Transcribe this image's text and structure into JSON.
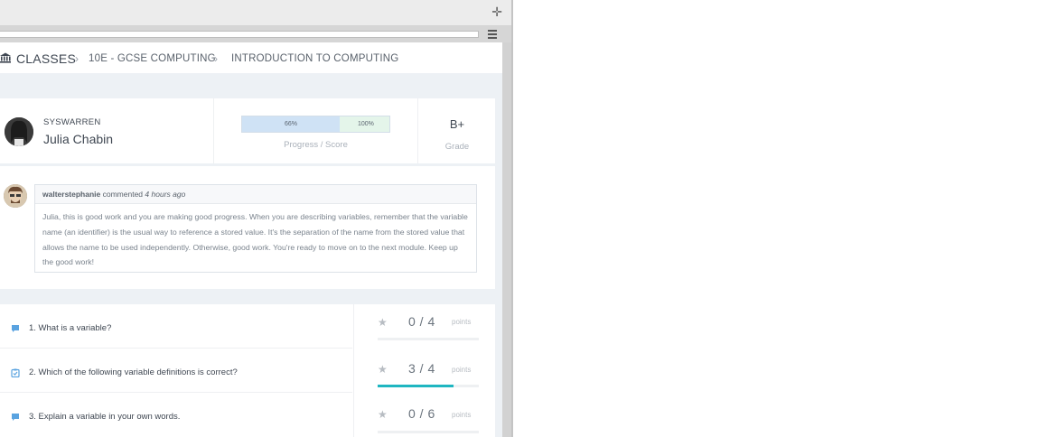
{
  "breadcrumb": {
    "root": "CLASSES",
    "items": [
      "10E - GCSE COMPUTING",
      "INTRODUCTION TO COMPUTING"
    ]
  },
  "student": {
    "username": "SYSWARREN",
    "name": "Julia Chabin",
    "progress_label": "66%",
    "progress_fraction": 0.66,
    "score_label": "100%",
    "progress_caption": "Progress / Score",
    "grade": "B+",
    "grade_caption": "Grade"
  },
  "comment": {
    "author": "walterstephanie",
    "verb": "commented",
    "time": "4 hours ago",
    "body": "Julia, this is good work and you are making good progress. When you are describing variables, remember that the variable name (an identifier) is the usual way to reference a stored value. It's the separation of the name from the stored value that allows the name to be used independently. Otherwise, good work. You're ready to move on to the next module. Keep up the good work!"
  },
  "questions": [
    {
      "text": "1. What is a variable?",
      "score": "0 / 4",
      "points_label": "points",
      "icon": "speech-bubble-icon",
      "fraction": 0
    },
    {
      "text": "2. Which of the following variable definitions is correct?",
      "score": "3 / 4",
      "points_label": "points",
      "icon": "clipboard-check-icon",
      "fraction": 0.75
    },
    {
      "text": "3. Explain a variable in your own words.",
      "score": "0 / 6",
      "points_label": "points",
      "icon": "speech-bubble-icon",
      "fraction": 0
    }
  ],
  "colors": {
    "accent": "#1fb6c1",
    "progress": "#cfe2f5",
    "score": "#e4f5ea",
    "icon_blue": "#5aa3e0"
  }
}
